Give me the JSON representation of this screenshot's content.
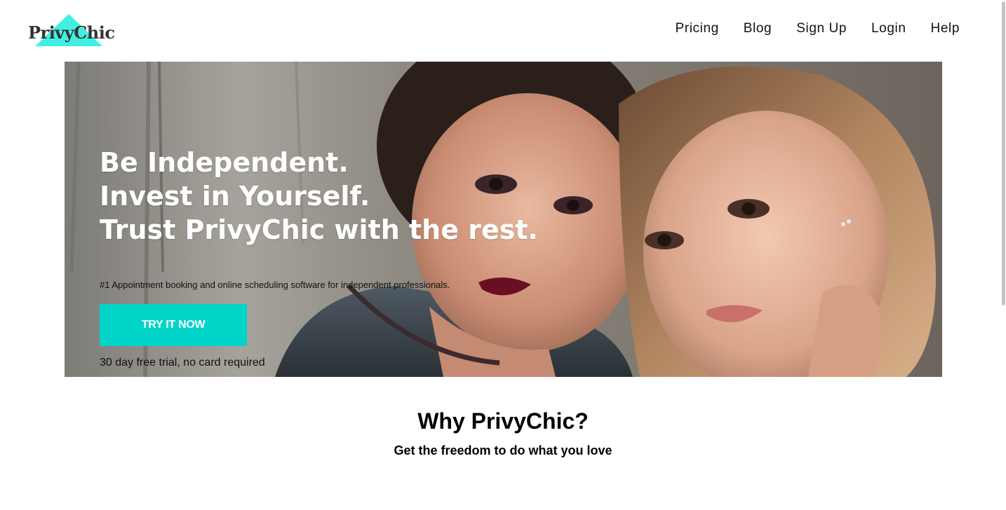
{
  "header": {
    "logo_text": "PrivyChic",
    "logo_accent_color": "#41f0e3",
    "nav": [
      {
        "label": "Pricing"
      },
      {
        "label": "Blog"
      },
      {
        "label": "Sign Up"
      },
      {
        "label": "Login"
      },
      {
        "label": "Help"
      }
    ]
  },
  "hero": {
    "image": "two-women-portrait-photo",
    "headline": [
      "Be Independent.",
      "Invest in Yourself.",
      "Trust PrivyChic with the rest."
    ],
    "subtitle": "#1 Appointment booking and online scheduling software for independent professionals.",
    "cta_label": "TRY IT NOW",
    "cta_color": "#00d4c8",
    "cta_note": "30 day free trial, no card required"
  },
  "why": {
    "title": "Why PrivyChic?",
    "subtitle": "Get the freedom to do what you love"
  }
}
